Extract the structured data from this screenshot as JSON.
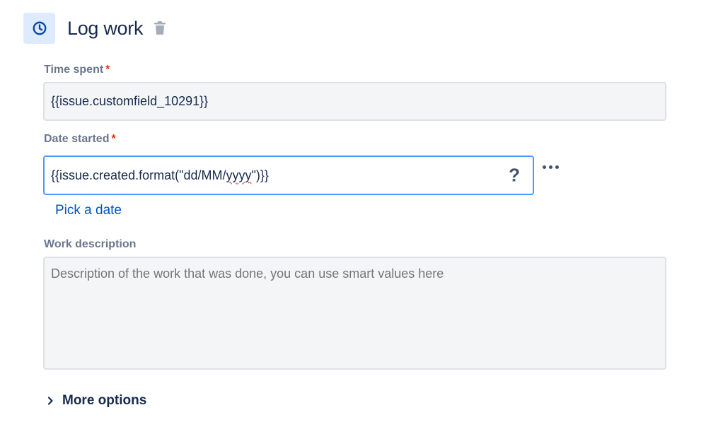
{
  "header": {
    "title": "Log work",
    "icons": {
      "main": "clock-icon",
      "delete": "trash-icon"
    },
    "accent_bg": "#DEEBFF",
    "accent": "#0747A6"
  },
  "time_spent": {
    "label": "Time spent",
    "required_mark": "*",
    "value": "{{issue.customfield_10291}}"
  },
  "date_started": {
    "label": "Date started",
    "required_mark": "*",
    "value_prefix": "{{issue.created.format(\"dd/MM/",
    "value_misspelled": "yyyy",
    "value_suffix": "\")}}",
    "help": "?",
    "pick_date_link": "Pick a date"
  },
  "work_description": {
    "label": "Work description",
    "placeholder": "Description of the work that was done, you can use smart values here",
    "value": ""
  },
  "more_options": {
    "label": "More options"
  },
  "colors": {
    "text": "#172B4D",
    "label": "#6B778C",
    "required": "#DE350B",
    "link": "#0052CC",
    "focus_border": "#4C9AFF"
  }
}
